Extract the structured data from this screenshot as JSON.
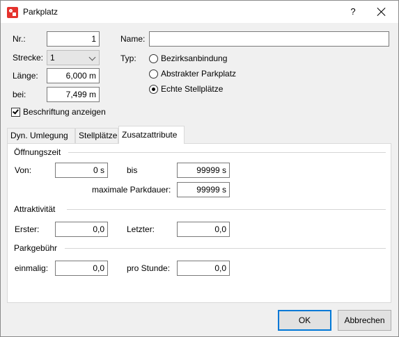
{
  "window": {
    "title": "Parkplatz",
    "help": "?"
  },
  "form": {
    "nr_label": "Nr.:",
    "nr_value": "1",
    "strecke_label": "Strecke:",
    "strecke_value": "1",
    "laenge_label": "Länge:",
    "laenge_value": "6,000 m",
    "bei_label": "bei:",
    "bei_value": "7,499 m",
    "name_label": "Name:",
    "name_value": "",
    "typ_label": "Typ:",
    "typ_options": [
      {
        "label": "Bezirksanbindung",
        "checked": false
      },
      {
        "label": "Abstrakter Parkplatz",
        "checked": false
      },
      {
        "label": "Echte Stellplätze",
        "checked": true
      }
    ],
    "beschriftung_label": "Beschriftung anzeigen",
    "beschriftung_checked": true
  },
  "tabs": [
    {
      "label": "Dyn. Umlegung",
      "active": false
    },
    {
      "label": "Stellplätze",
      "active": false
    },
    {
      "label": "Zusatzattribute",
      "active": true
    }
  ],
  "zusatz": {
    "oeffnungszeit": {
      "title": "Öffnungszeit",
      "von_label": "Von:",
      "von_value": "0 s",
      "bis_label": "bis",
      "bis_value": "99999 s",
      "max_label": "maximale Parkdauer:",
      "max_value": "99999 s"
    },
    "attraktivitaet": {
      "title": "Attraktivität",
      "erster_label": "Erster:",
      "erster_value": "0,0",
      "letzter_label": "Letzter:",
      "letzter_value": "0,0"
    },
    "parkgebuehr": {
      "title": "Parkgebühr",
      "einmalig_label": "einmalig:",
      "einmalig_value": "0,0",
      "pro_stunde_label": "pro Stunde:",
      "pro_stunde_value": "0,0"
    }
  },
  "buttons": {
    "ok": "OK",
    "cancel": "Abbrechen"
  },
  "colors": {
    "accent": "#0078d7",
    "app_icon": "#e5322d",
    "dialog_bg": "#f0f0f0"
  }
}
